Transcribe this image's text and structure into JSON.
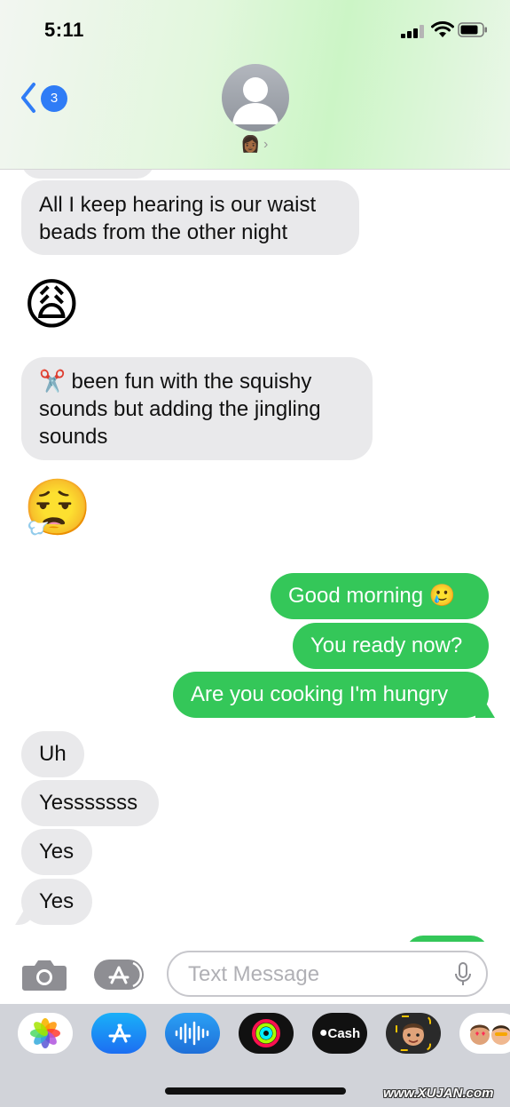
{
  "status_bar": {
    "time": "5:11"
  },
  "header": {
    "back_badge_count": "3",
    "contact_emoji": "👩🏾",
    "contact_chevron": "›"
  },
  "messages": [
    {
      "type": "text",
      "direction": "incoming",
      "text": "All I keep hearing is our waist\nbeads from the other night"
    },
    {
      "type": "emoji",
      "direction": "incoming",
      "text": "😩"
    },
    {
      "type": "text",
      "direction": "incoming",
      "text": "✂️ been fun with the squishy\nsounds but adding the jingling\nsounds"
    },
    {
      "type": "emoji",
      "direction": "incoming",
      "text": "😮‍💨"
    },
    {
      "type": "text",
      "direction": "outgoing",
      "text": "Good morning 🥲"
    },
    {
      "type": "text",
      "direction": "outgoing",
      "text": "You ready now?"
    },
    {
      "type": "text",
      "direction": "outgoing",
      "text": "Are you cooking I'm hungry"
    },
    {
      "type": "text",
      "direction": "incoming",
      "text": "Uh"
    },
    {
      "type": "text",
      "direction": "incoming",
      "text": "Yesssssss"
    },
    {
      "type": "text",
      "direction": "incoming",
      "text": "Yes"
    },
    {
      "type": "text",
      "direction": "incoming",
      "text": "Yes"
    }
  ],
  "input": {
    "placeholder": "Text Message",
    "value": ""
  },
  "app_drawer": [
    {
      "name": "photos-app",
      "icon": "photos-icon",
      "label": ""
    },
    {
      "name": "app-store-app",
      "icon": "app-store-icon",
      "label": ""
    },
    {
      "name": "audio-message-app",
      "icon": "waveform-icon",
      "label": ""
    },
    {
      "name": "fitness-app",
      "icon": "activity-rings-icon",
      "label": ""
    },
    {
      "name": "apple-cash-app",
      "icon": "apple-cash-icon",
      "label": "Cash"
    },
    {
      "name": "memoji-app",
      "icon": "memoji-icon",
      "label": ""
    },
    {
      "name": "memoji-stickers-app",
      "icon": "memoji-stickers-icon",
      "label": ""
    }
  ],
  "watermark": "www.XUJAN.com",
  "colors": {
    "incoming_bubble": "#e9e9eb",
    "outgoing_bubble": "#34c759",
    "accent": "#2f7cf6",
    "drawer_background": "#d1d3d9"
  }
}
